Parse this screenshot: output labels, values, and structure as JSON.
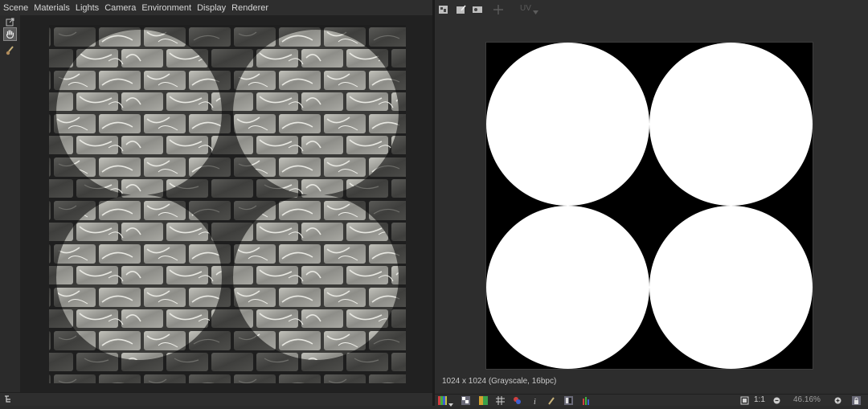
{
  "menubar": {
    "items": [
      "Scene",
      "Materials",
      "Lights",
      "Camera",
      "Environment",
      "Display",
      "Renderer"
    ]
  },
  "viewport": {
    "tools": [
      "export-icon",
      "hand-pan-icon",
      "brush-icon"
    ]
  },
  "right_toolbar": {
    "icons": [
      "new-image-icon",
      "edit-image-icon",
      "display-icon",
      "move-icon"
    ],
    "uv_label": "UV"
  },
  "image_view": {
    "info": "1024 x 1024 (Grayscale, 16bpc)"
  },
  "bottom_bar": {
    "ratio_label": "1:1",
    "zoom_value": "46.16%"
  },
  "colors": {
    "background": "#2d2d2d",
    "canvas": "#000000",
    "mask": "#ffffff",
    "accent_active": "#6a6a78"
  }
}
